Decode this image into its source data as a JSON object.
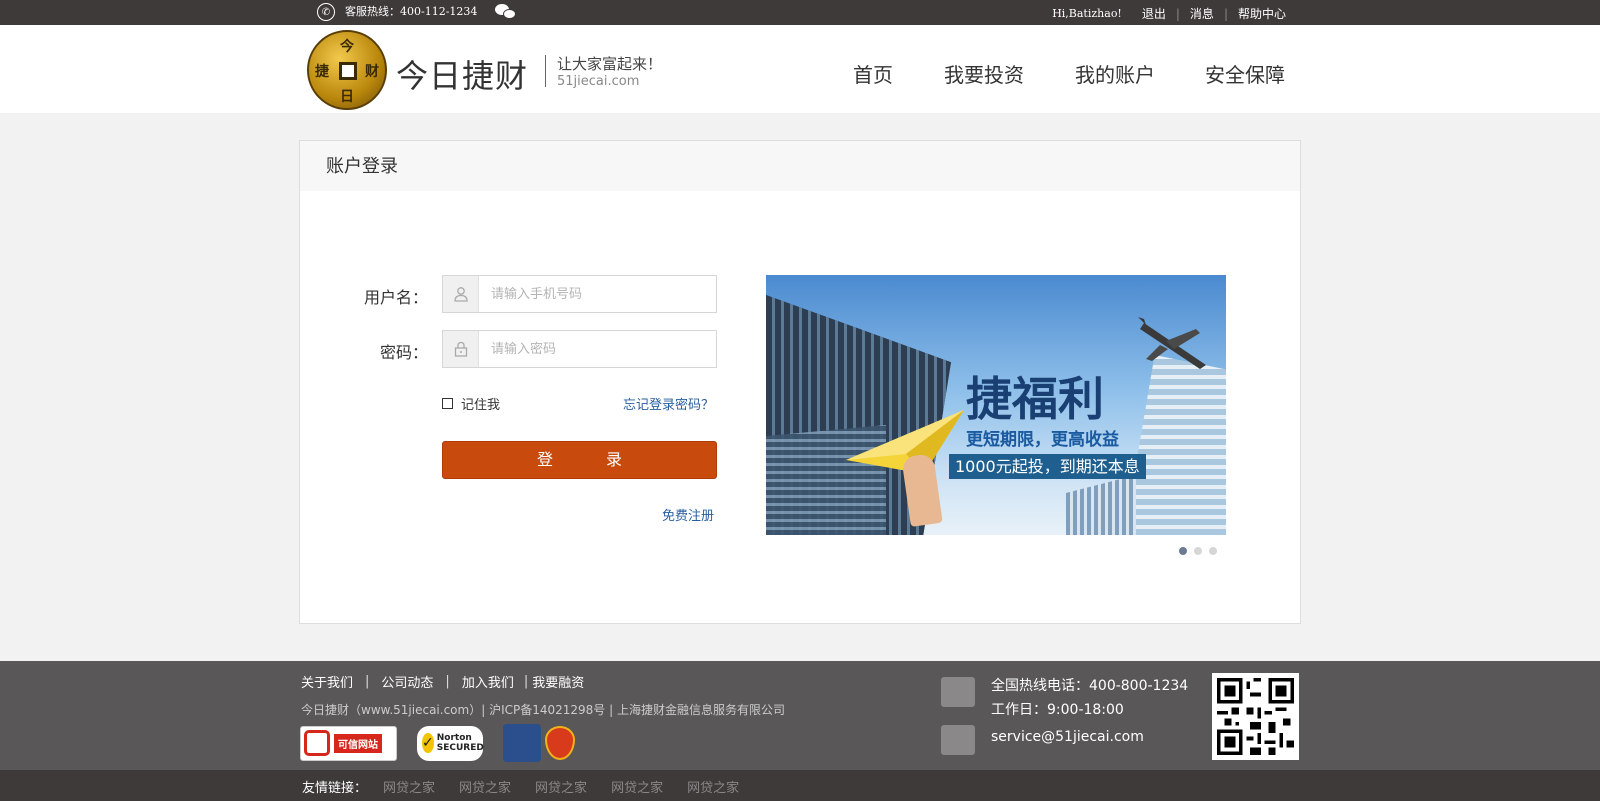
{
  "topbar": {
    "hotline": "客服热线：400-112-1234",
    "greeting": "Hi,Batizhao!",
    "links": [
      "退出",
      "消息",
      "帮助中心"
    ]
  },
  "header": {
    "logo_chars": [
      "今",
      "捷",
      "财",
      "日"
    ],
    "brand": "今日捷财",
    "slogan": "让大家富起来！",
    "domain": "51jiecai.com",
    "nav": [
      "首页",
      "我要投资",
      "我的账户",
      "安全保障"
    ]
  },
  "login": {
    "title": "账户登录",
    "username_label": "用户名：",
    "username_placeholder": "请输入手机号码",
    "password_label": "密码：",
    "password_placeholder": "请输入密码",
    "remember": "记住我",
    "forgot": "忘记登录密码？",
    "submit": "登 录",
    "register": "免费注册"
  },
  "banner": {
    "title": "捷福利",
    "subtitle": "更短期限，更高收益",
    "tag": "1000元起投，到期还本息",
    "slides": 3,
    "active_slide": 1
  },
  "footer": {
    "links": [
      "关于我们",
      "公司动态",
      "加入我们",
      "我要融资"
    ],
    "info": "今日捷财（www.51jiecai.com）| 沪ICP备14021298号 | 上海捷财金融信息服务有限公司",
    "hotline": "全国热线电话：400-800-1234",
    "hours": "工作日：9:00-18:00",
    "email": "service@51jiecai.com",
    "badge_cx": "可信网站",
    "badge_norton": "Norton SECURED"
  },
  "friends": {
    "label": "友情链接：",
    "links": [
      "网贷之家",
      "网贷之家",
      "网贷之家",
      "网贷之家",
      "网贷之家"
    ]
  },
  "colors": {
    "topbar_bg": "#3e3a39",
    "login_button": "#c84a0c",
    "link_blue": "#2a5f9e",
    "footer_bg": "#595757"
  }
}
